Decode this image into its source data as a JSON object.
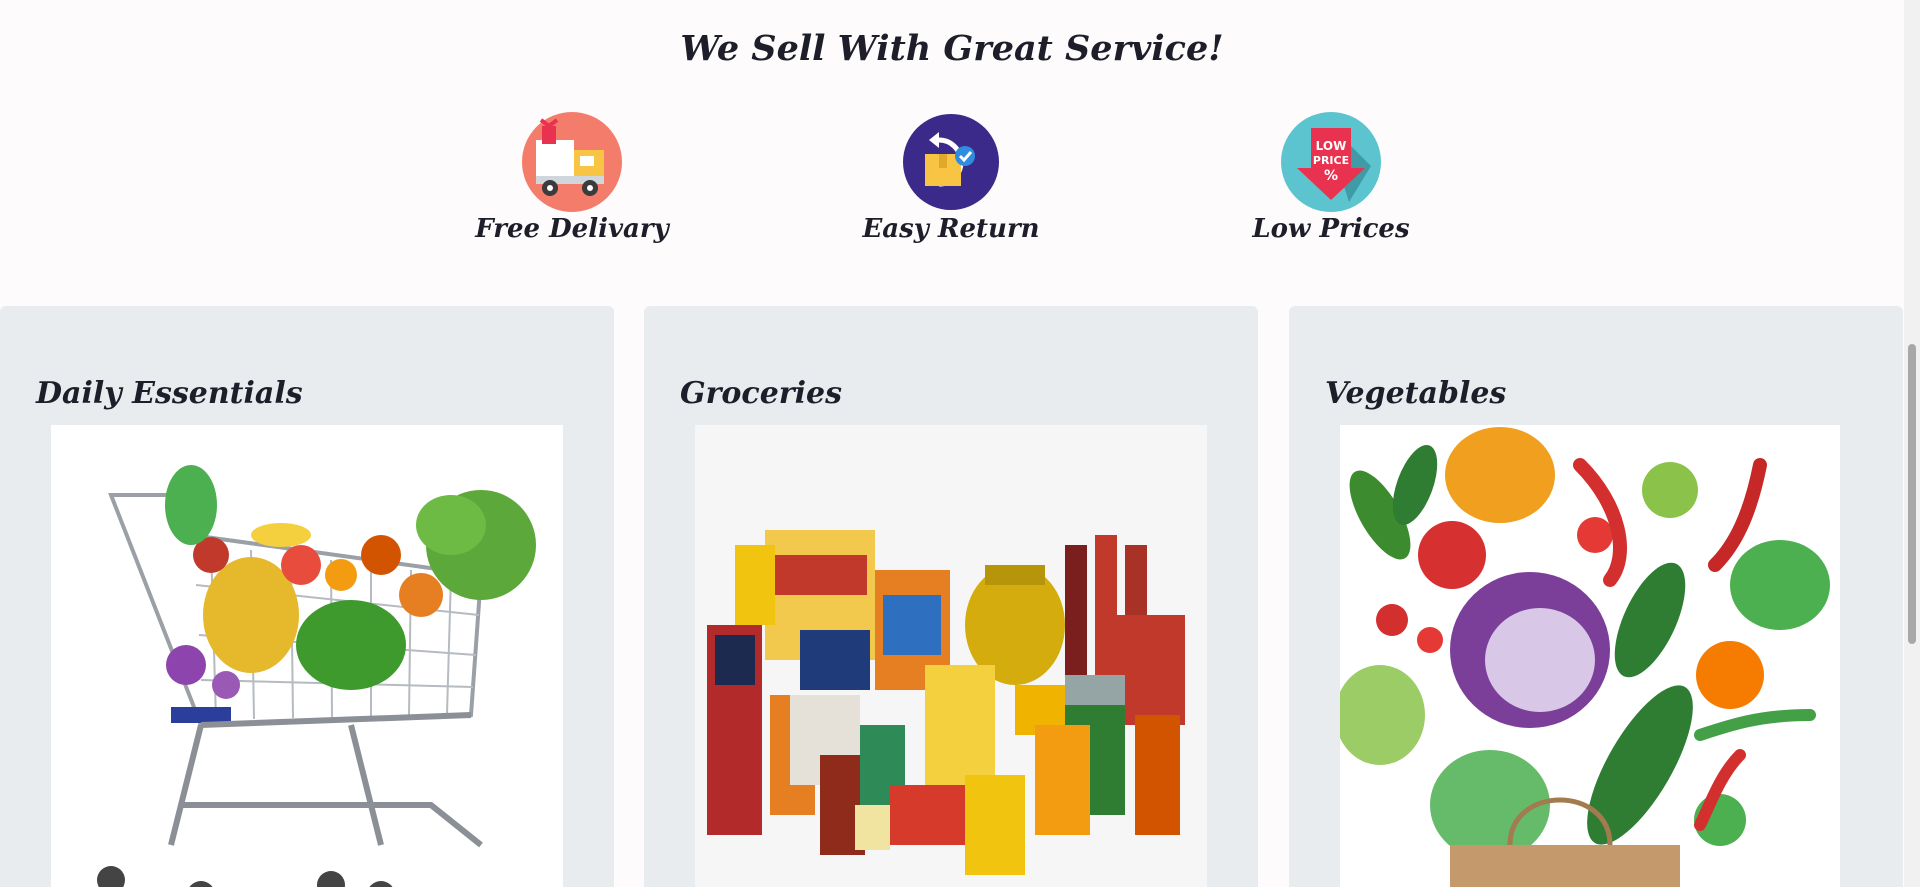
{
  "service": {
    "title": "We Sell With Great Service!",
    "items": [
      {
        "label": "Free Delivary",
        "icon": "delivery-truck-icon"
      },
      {
        "label": "Easy Return",
        "icon": "return-box-icon"
      },
      {
        "label": "Low Prices",
        "icon": "low-price-tag-icon",
        "badge_lines": [
          "LOW",
          "PRICE",
          "%"
        ]
      }
    ]
  },
  "categories": [
    {
      "title": "Daily Essentials",
      "image": "shopping-cart-with-produce"
    },
    {
      "title": "Groceries",
      "image": "packaged-grocery-products"
    },
    {
      "title": "Vegetables",
      "image": "fresh-vegetables-with-bag"
    }
  ],
  "colors": {
    "page_background": "#fdfbfb",
    "card_background": "#e9ecef",
    "heading_text": "#1e1e2a",
    "delivery_icon_bg": "#f47c6a",
    "return_icon_bg": "#3b2a8a",
    "price_icon_bg": "#5cc4cf",
    "price_tag": "#e8324f"
  }
}
